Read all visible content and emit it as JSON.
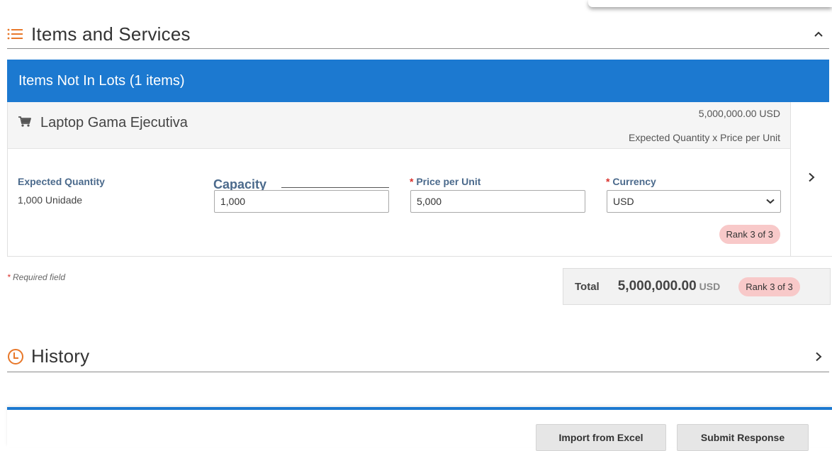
{
  "items_section": {
    "title": "Items and Services",
    "icon": "list-icon",
    "toggle_icon": "chevron-up-icon"
  },
  "lot": {
    "header": "Items Not In Lots (1 items)"
  },
  "item": {
    "icon": "cart-icon",
    "name": "Laptop Gama Ejecutiva",
    "total": "5,000,000.00 USD",
    "formula": "Expected Quantity x Price per Unit",
    "expected_quantity": {
      "label": "Expected Quantity",
      "value": "1,000 Unidade"
    },
    "capacity": {
      "label": "Capacity",
      "value": "1,000"
    },
    "price_per_unit": {
      "required_mark": "*",
      "label": "Price per Unit",
      "value": "5,000"
    },
    "currency": {
      "required_mark": "*",
      "label": "Currency",
      "selected": "USD"
    },
    "rank": "Rank 3 of 3",
    "arrow_icon": "chevron-right-icon"
  },
  "required_note": {
    "mark": "*",
    "text": "Required field"
  },
  "totals": {
    "label": "Total",
    "amount": "5,000,000.00",
    "currency": "USD",
    "rank": "Rank 3 of 3"
  },
  "history_section": {
    "title": "History",
    "icon": "clock-icon",
    "toggle_icon": "chevron-right-icon"
  },
  "footer": {
    "import_label": "Import from Excel",
    "submit_label": "Submit Response"
  },
  "colors": {
    "accent_blue": "#1c79d0",
    "icon_orange": "#e8782a",
    "rank_badge": "#f8c9c9",
    "required_red": "#d9302b"
  }
}
